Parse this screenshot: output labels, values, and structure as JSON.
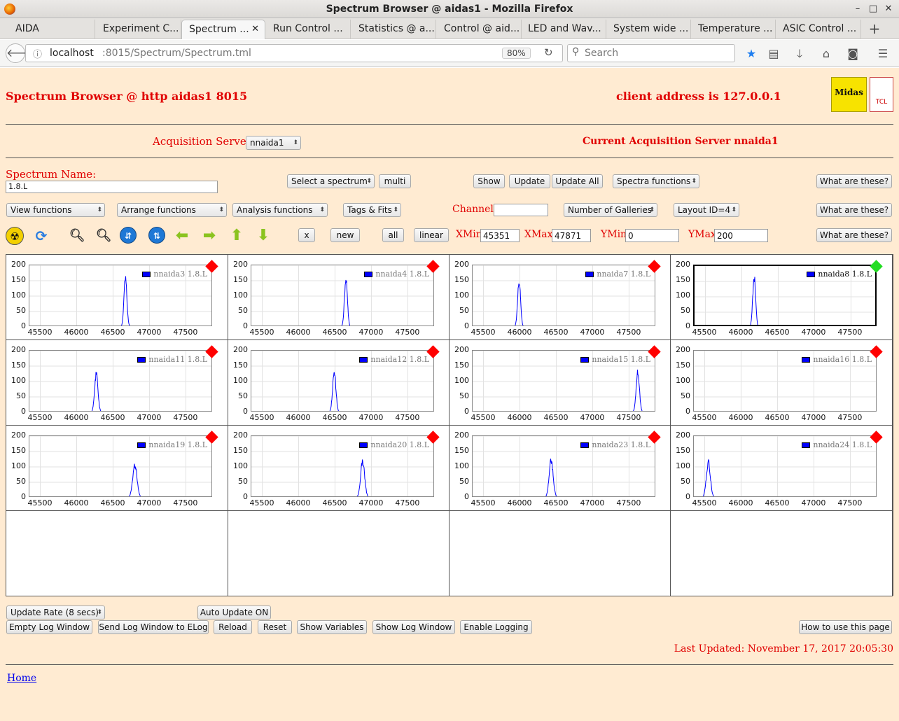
{
  "window": {
    "title": "Spectrum Browser @ aidas1 - Mozilla Firefox"
  },
  "tabs": [
    {
      "label": "AIDA"
    },
    {
      "label": "Experiment C..."
    },
    {
      "label": "Spectrum ..."
    },
    {
      "label": "Run Control ..."
    },
    {
      "label": "Statistics @ a..."
    },
    {
      "label": "Control @ aid..."
    },
    {
      "label": "LED and Wav..."
    },
    {
      "label": "System wide ..."
    },
    {
      "label": "Temperature ..."
    },
    {
      "label": "ASIC Control ..."
    }
  ],
  "browser": {
    "url_host": "localhost",
    "url_path": ":8015/Spectrum/Spectrum.tml",
    "zoom": "80%",
    "search_placeholder": "Search"
  },
  "header": {
    "title": "Spectrum Browser @ http aidas1 8015",
    "client": "client address is 127.0.0.1",
    "logo_text": "Midas",
    "logo2_text": "TCL"
  },
  "acq": {
    "label": "Acquisition Servers",
    "server_select": "nnaida1",
    "current": "Current Acquisition Server nnaida1"
  },
  "controls": {
    "spectrum_name_label": "Spectrum Name:",
    "spectrum_name_value": "1.8.L",
    "select_spectrum": "Select a spectrum",
    "multi": "multi",
    "show": "Show",
    "update": "Update",
    "update_all": "Update All",
    "spectra_functions": "Spectra functions",
    "what": "What are these?",
    "view_functions": "View functions",
    "arrange_functions": "Arrange functions",
    "analysis_functions": "Analysis functions",
    "tags_fits": "Tags & Fits",
    "channel_label": "Channel:",
    "channel_value": "",
    "num_galleries": "Number of Galleries",
    "layout": "Layout ID=4",
    "x": "x",
    "new": "new",
    "all": "all",
    "linear": "linear",
    "xmin_label": "XMin",
    "xmin": "45351",
    "xmax_label": "XMax",
    "xmax": "47871",
    "ymin_label": "YMin",
    "ymin": "0",
    "ymax_label": "YMax",
    "ymax": "200"
  },
  "tool_icons": [
    "radiation-icon",
    "refresh-icon",
    "zoom-in-icon",
    "zoom-out-icon",
    "expand-y-icon",
    "compress-y-icon",
    "arrow-left-icon",
    "arrow-right-icon",
    "arrow-up-icon",
    "arrow-down-icon"
  ],
  "chart_data": [
    {
      "type": "line",
      "series": [
        {
          "name": "nnaida3 1.8.L",
          "peak_x": 46670,
          "peak_y": 158,
          "width": 40
        }
      ],
      "xlim": [
        45351,
        47871
      ],
      "ylim": [
        0,
        200
      ],
      "xticks": [
        "45500",
        "46000",
        "46500",
        "47000",
        "47500"
      ],
      "yticks": [
        "0",
        "50",
        "100",
        "150",
        "200"
      ],
      "status": "red"
    },
    {
      "type": "line",
      "series": [
        {
          "name": "nnaida4 1.8.L",
          "peak_x": 46650,
          "peak_y": 158,
          "width": 40
        }
      ],
      "xlim": [
        45351,
        47871
      ],
      "ylim": [
        0,
        200
      ],
      "xticks": [
        "45500",
        "46000",
        "46500",
        "47000",
        "47500"
      ],
      "yticks": [
        "0",
        "50",
        "100",
        "150",
        "200"
      ],
      "status": "red"
    },
    {
      "type": "line",
      "series": [
        {
          "name": "nnaida7 1.8.L",
          "peak_x": 45990,
          "peak_y": 148,
          "width": 40
        }
      ],
      "xlim": [
        45351,
        47871
      ],
      "ylim": [
        0,
        200
      ],
      "xticks": [
        "45500",
        "46000",
        "46500",
        "47000",
        "47500"
      ],
      "yticks": [
        "0",
        "50",
        "100",
        "150",
        "200"
      ],
      "status": "red"
    },
    {
      "type": "line",
      "series": [
        {
          "name": "nnaida8 1.8.L",
          "peak_x": 46170,
          "peak_y": 165,
          "width": 40
        }
      ],
      "xlim": [
        45351,
        47871
      ],
      "ylim": [
        0,
        200
      ],
      "xticks": [
        "45500",
        "46000",
        "46500",
        "47000",
        "47500"
      ],
      "yticks": [
        "0",
        "50",
        "100",
        "150",
        "200"
      ],
      "status": "green",
      "selected": true
    },
    {
      "type": "line",
      "series": [
        {
          "name": "nnaida11 1.8.L",
          "peak_x": 46270,
          "peak_y": 125,
          "width": 45
        }
      ],
      "xlim": [
        45351,
        47871
      ],
      "ylim": [
        0,
        200
      ],
      "xticks": [
        "45500",
        "46000",
        "46500",
        "47000",
        "47500"
      ],
      "yticks": [
        "0",
        "50",
        "100",
        "150",
        "200"
      ],
      "status": "red"
    },
    {
      "type": "line",
      "series": [
        {
          "name": "nnaida12 1.8.L",
          "peak_x": 46490,
          "peak_y": 128,
          "width": 45
        }
      ],
      "xlim": [
        45351,
        47871
      ],
      "ylim": [
        0,
        200
      ],
      "xticks": [
        "45500",
        "46000",
        "46500",
        "47000",
        "47500"
      ],
      "yticks": [
        "0",
        "50",
        "100",
        "150",
        "200"
      ],
      "status": "red"
    },
    {
      "type": "line",
      "series": [
        {
          "name": "nnaida15 1.8.L",
          "peak_x": 47620,
          "peak_y": 128,
          "width": 45
        }
      ],
      "xlim": [
        45351,
        47871
      ],
      "ylim": [
        0,
        200
      ],
      "xticks": [
        "45500",
        "46000",
        "46500",
        "47000",
        "47500"
      ],
      "yticks": [
        "0",
        "50",
        "100",
        "150",
        "200"
      ],
      "status": "red"
    },
    {
      "type": "line",
      "series": [
        {
          "name": "nnaida16 1.8.L",
          "peak_x": null,
          "peak_y": 0,
          "width": 0
        }
      ],
      "xlim": [
        45351,
        47871
      ],
      "ylim": [
        0,
        200
      ],
      "xticks": [
        "45500",
        "46000",
        "46500",
        "47000",
        "47500"
      ],
      "yticks": [
        "0",
        "50",
        "100",
        "150",
        "200"
      ],
      "status": "red"
    },
    {
      "type": "line",
      "series": [
        {
          "name": "nnaida19 1.8.L",
          "peak_x": 46800,
          "peak_y": 103,
          "width": 60
        }
      ],
      "xlim": [
        45351,
        47871
      ],
      "ylim": [
        0,
        200
      ],
      "xticks": [
        "45500",
        "46000",
        "46500",
        "47000",
        "47500"
      ],
      "yticks": [
        "0",
        "50",
        "100",
        "150",
        "200"
      ],
      "status": "red"
    },
    {
      "type": "line",
      "series": [
        {
          "name": "nnaida20 1.8.L",
          "peak_x": 46880,
          "peak_y": 118,
          "width": 55
        }
      ],
      "xlim": [
        45351,
        47871
      ],
      "ylim": [
        0,
        200
      ],
      "xticks": [
        "45500",
        "46000",
        "46500",
        "47000",
        "47500"
      ],
      "yticks": [
        "0",
        "50",
        "100",
        "150",
        "200"
      ],
      "status": "red"
    },
    {
      "type": "line",
      "series": [
        {
          "name": "nnaida23 1.8.L",
          "peak_x": 46430,
          "peak_y": 120,
          "width": 55
        }
      ],
      "xlim": [
        45351,
        47871
      ],
      "ylim": [
        0,
        200
      ],
      "xticks": [
        "45500",
        "46000",
        "46500",
        "47000",
        "47500"
      ],
      "yticks": [
        "0",
        "50",
        "100",
        "150",
        "200"
      ],
      "status": "red"
    },
    {
      "type": "line",
      "series": [
        {
          "name": "nnaida24 1.8.L",
          "peak_x": 45550,
          "peak_y": 115,
          "width": 55
        }
      ],
      "xlim": [
        45351,
        47871
      ],
      "ylim": [
        0,
        200
      ],
      "xticks": [
        "45500",
        "46000",
        "46500",
        "47000",
        "47500"
      ],
      "yticks": [
        "0",
        "50",
        "100",
        "150",
        "200"
      ],
      "status": "red"
    }
  ],
  "colors": {
    "trace": "#0000ff",
    "status_red": "#ff0000",
    "status_green": "#22dd22",
    "page_bg": "#ffebd2",
    "heading": "#e00000"
  },
  "footer": {
    "update_rate": "Update Rate (8 secs)",
    "auto_update": "Auto Update ON",
    "empty_log": "Empty Log Window",
    "send_log": "Send Log Window to ELog",
    "reload": "Reload",
    "reset": "Reset",
    "show_vars": "Show Variables",
    "show_log": "Show Log Window",
    "enable_logging": "Enable Logging",
    "how_to": "How to use this page",
    "last_updated": "Last Updated: November 17, 2017 20:05:30",
    "home": "Home"
  }
}
